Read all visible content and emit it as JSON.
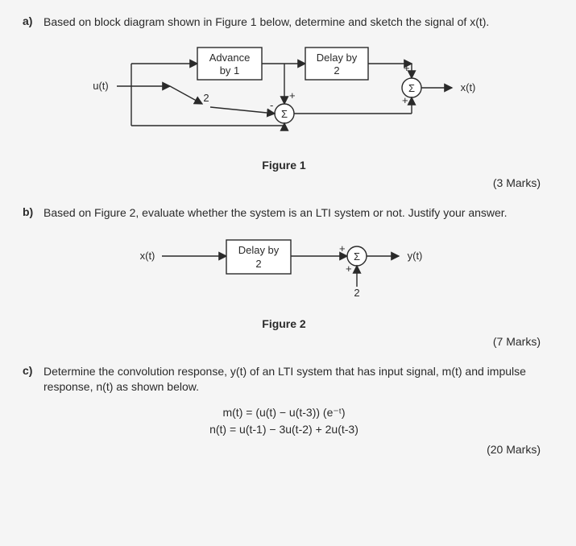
{
  "a": {
    "label": "a)",
    "text": "Based on block diagram shown in Figure 1 below, determine and sketch the signal of x(t).",
    "marks": "(3 Marks)",
    "fig_caption": "Figure 1",
    "diagram": {
      "input_label": "u(t)",
      "block1": {
        "line1": "Advance",
        "line2": "by 1"
      },
      "block2": {
        "line1": "Delay by",
        "line2": "2"
      },
      "const": "2",
      "sum1_top": "+",
      "sum1_left": "-",
      "sum1_symbol": "Σ",
      "sum2_top": "+",
      "sum2_bottom": "+",
      "sum2_symbol": "Σ",
      "output_label": "x(t)"
    }
  },
  "b": {
    "label": "b)",
    "text": "Based on Figure 2, evaluate whether the system is an LTI system or not. Justify your answer.",
    "marks": "(7 Marks)",
    "fig_caption": "Figure 2",
    "diagram": {
      "input_label": "x(t)",
      "block": {
        "line1": "Delay by",
        "line2": "2"
      },
      "const": "2",
      "sum_top": "+",
      "sum_bottom": "+",
      "sum_symbol": "Σ",
      "output_label": "y(t)"
    }
  },
  "c": {
    "label": "c)",
    "text": "Determine the convolution response, y(t) of an LTI system that has input signal, m(t) and impulse response, n(t) as shown below.",
    "marks": "(20 Marks)",
    "equations": {
      "m": "m(t) = (u(t) − u(t-3)) (e⁻ᵗ)",
      "n": "n(t) = u(t-1) − 3u(t-2) + 2u(t-3)"
    }
  }
}
